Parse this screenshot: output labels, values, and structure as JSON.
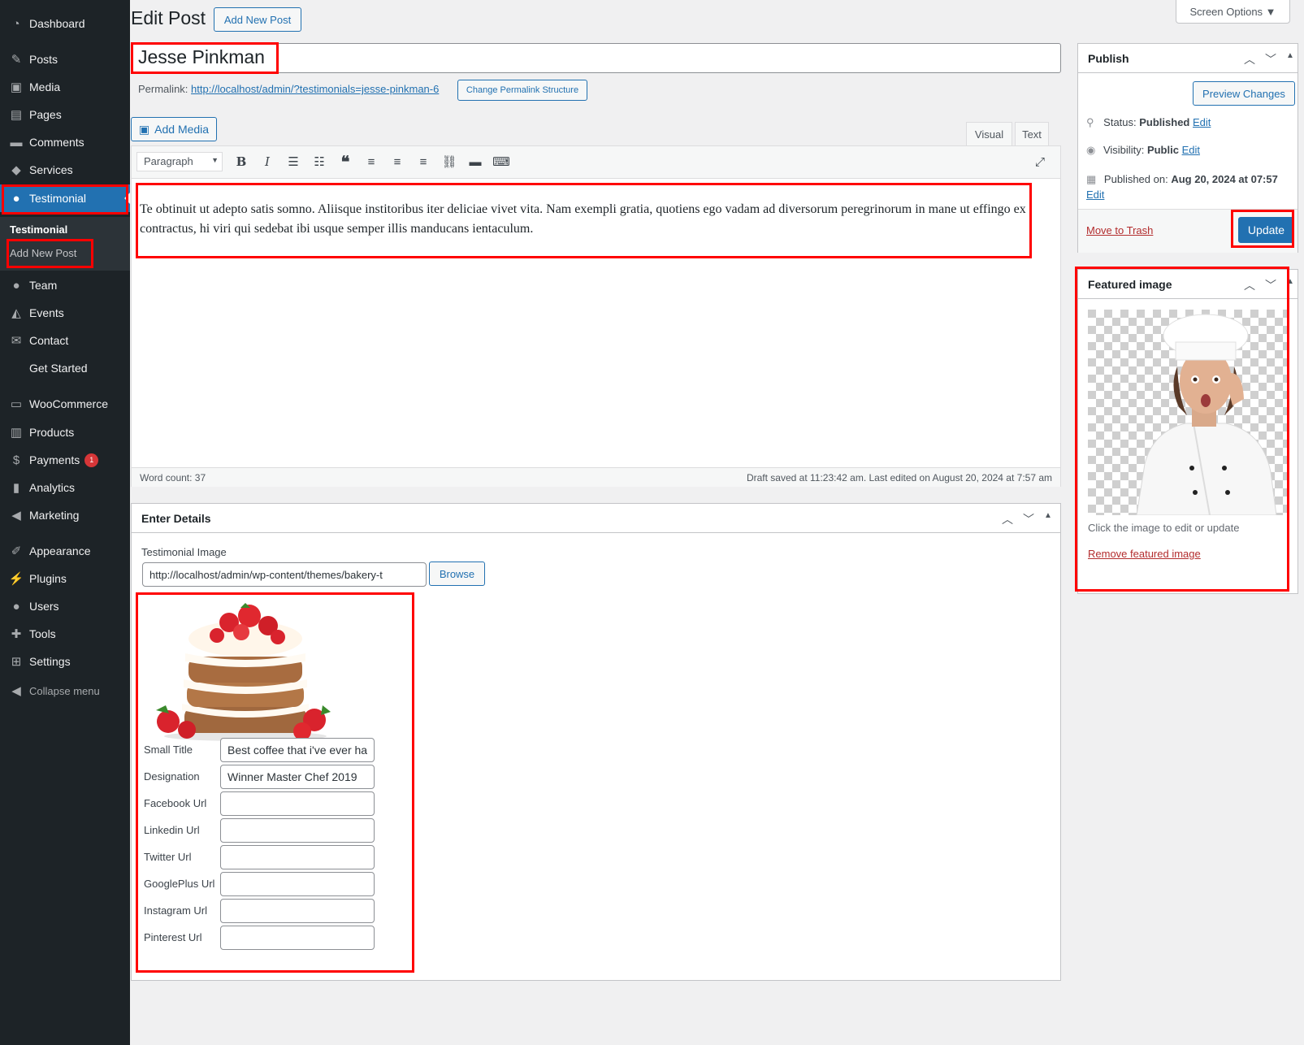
{
  "sidebar": {
    "items": [
      {
        "label": "Dashboard",
        "icon": "dashboard-icon",
        "glyph": "◔"
      },
      {
        "label": "Posts",
        "icon": "pin-icon",
        "glyph": "✎"
      },
      {
        "label": "Media",
        "icon": "media-icon",
        "glyph": "▣"
      },
      {
        "label": "Pages",
        "icon": "pages-icon",
        "glyph": "▤"
      },
      {
        "label": "Comments",
        "icon": "comment-icon",
        "glyph": "▬"
      },
      {
        "label": "Services",
        "icon": "tag-icon",
        "glyph": "◆"
      },
      {
        "label": "Testimonial",
        "icon": "person-icon",
        "glyph": "●"
      },
      {
        "label": "Team",
        "icon": "person-icon",
        "glyph": "●"
      },
      {
        "label": "Events",
        "icon": "mortarboard-icon",
        "glyph": "◭"
      },
      {
        "label": "Contact",
        "icon": "mail-icon",
        "glyph": "✉"
      },
      {
        "label": "Get Started",
        "icon": "",
        "glyph": ""
      },
      {
        "label": "WooCommerce",
        "icon": "woo-icon",
        "glyph": "▭"
      },
      {
        "label": "Products",
        "icon": "archive-icon",
        "glyph": "▥"
      },
      {
        "label": "Payments",
        "icon": "dollar-icon",
        "glyph": "$",
        "badge": "1"
      },
      {
        "label": "Analytics",
        "icon": "bar-chart-icon",
        "glyph": "▮"
      },
      {
        "label": "Marketing",
        "icon": "megaphone-icon",
        "glyph": "◀"
      },
      {
        "label": "Appearance",
        "icon": "brush-icon",
        "glyph": "✐"
      },
      {
        "label": "Plugins",
        "icon": "plug-icon",
        "glyph": "⚡"
      },
      {
        "label": "Users",
        "icon": "users-icon",
        "glyph": "●"
      },
      {
        "label": "Tools",
        "icon": "wrench-icon",
        "glyph": "✚"
      },
      {
        "label": "Settings",
        "icon": "settings-icon",
        "glyph": "⊞"
      }
    ],
    "submenu": {
      "title": "Testimonial",
      "add_new": "Add New Post"
    },
    "collapse": "Collapse menu"
  },
  "header": {
    "title": "Edit Post",
    "add_new": "Add New Post",
    "screen_options": "Screen Options ▼"
  },
  "post": {
    "title": "Jesse Pinkman",
    "permalink_label": "Permalink:",
    "permalink_url": "http://localhost/admin/?testimonials=jesse-pinkman-6",
    "change_permalink": "Change Permalink Structure",
    "add_media": "Add Media",
    "tab_visual": "Visual",
    "tab_text": "Text",
    "format": "Paragraph",
    "content": "Te obtinuit ut adepto satis somno. Aliisque institoribus iter deliciae vivet vita. Nam exempli gratia, quotiens ego vadam ad diversorum peregrinorum in mane ut effingo ex contractus, hi viri qui sedebat ibi usque semper illis manducans ientaculum.",
    "word_count": "Word count: 37",
    "draft_saved": "Draft saved at 11:23:42 am. Last edited on August 20, 2024 at 7:57 am"
  },
  "details": {
    "title": "Enter Details",
    "image_label": "Testimonial Image",
    "image_url": "http://localhost/admin/wp-content/themes/bakery-t",
    "browse": "Browse",
    "fields": [
      {
        "label": "Small Title",
        "value": "Best coffee that i've ever ha"
      },
      {
        "label": "Designation",
        "value": "Winner Master Chef 2019"
      },
      {
        "label": "Facebook Url",
        "value": ""
      },
      {
        "label": "Linkedin Url",
        "value": ""
      },
      {
        "label": "Twitter Url",
        "value": ""
      },
      {
        "label": "GooglePlus Url",
        "value": ""
      },
      {
        "label": "Instagram Url",
        "value": ""
      },
      {
        "label": "Pinterest Url",
        "value": ""
      }
    ]
  },
  "publish": {
    "title": "Publish",
    "preview": "Preview Changes",
    "status_label": "Status:",
    "status_value": "Published",
    "visibility_label": "Visibility:",
    "visibility_value": "Public",
    "published_label": "Published on:",
    "published_value": "Aug 20, 2024 at 07:57",
    "edit": "Edit",
    "trash": "Move to Trash",
    "update": "Update"
  },
  "featured": {
    "title": "Featured image",
    "hint": "Click the image to edit or update",
    "remove": "Remove featured image"
  },
  "colors": {
    "accent": "#2271b1",
    "sidebar": "#1d2327",
    "highlight": "#ff0000",
    "trash": "#b32d2e"
  }
}
